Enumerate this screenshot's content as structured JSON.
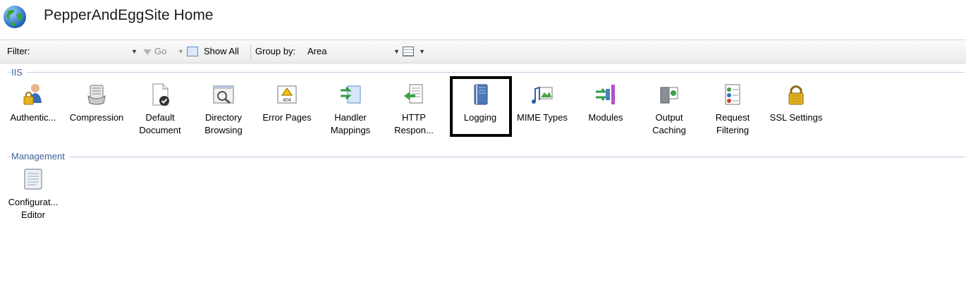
{
  "header": {
    "title": "PepperAndEggSite Home",
    "icon": "globe-icon"
  },
  "toolbar": {
    "filter_label": "Filter:",
    "filter_value": "",
    "go_label": "Go",
    "show_all_label": "Show All",
    "group_by_label": "Group by:",
    "group_by_value": "Area"
  },
  "sections": {
    "iis": {
      "label": "IIS",
      "items": [
        {
          "label": "Authentic...",
          "icon": "authentication-icon"
        },
        {
          "label": "Compression",
          "icon": "compression-icon"
        },
        {
          "label": "Default\nDocument",
          "icon": "default-document-icon"
        },
        {
          "label": "Directory\nBrowsing",
          "icon": "directory-browsing-icon"
        },
        {
          "label": "Error Pages",
          "icon": "error-pages-icon"
        },
        {
          "label": "Handler\nMappings",
          "icon": "handler-mappings-icon"
        },
        {
          "label": "HTTP\nRespon...",
          "icon": "http-response-icon"
        },
        {
          "label": "Logging",
          "icon": "logging-icon"
        },
        {
          "label": "MIME Types",
          "icon": "mime-types-icon"
        },
        {
          "label": "Modules",
          "icon": "modules-icon"
        },
        {
          "label": "Output\nCaching",
          "icon": "output-caching-icon"
        },
        {
          "label": "Request\nFiltering",
          "icon": "request-filtering-icon"
        },
        {
          "label": "SSL Settings",
          "icon": "ssl-settings-icon"
        }
      ]
    },
    "management": {
      "label": "Management",
      "items": [
        {
          "label": "Configurat...\nEditor",
          "icon": "configuration-editor-icon"
        }
      ]
    }
  },
  "error_pages_icon_text": "404"
}
